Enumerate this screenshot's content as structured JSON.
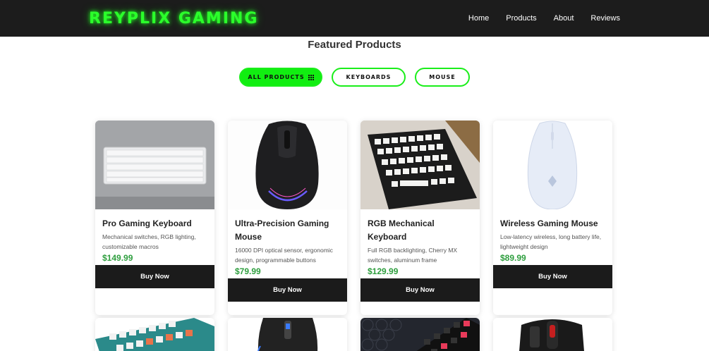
{
  "brand": {
    "logo_text": "REYPLIX GAMING",
    "accent": "#22ff22"
  },
  "nav": {
    "links": [
      "Home",
      "Products",
      "About",
      "Reviews"
    ]
  },
  "section": {
    "title": "Featured Products"
  },
  "filters": [
    {
      "label": "ALL PRODUCTS",
      "active": true,
      "icon": "grid-icon"
    },
    {
      "label": "KEYBOARDS",
      "active": false
    },
    {
      "label": "MOUSE",
      "active": false
    }
  ],
  "products": [
    {
      "name": "Pro Gaming Keyboard",
      "description": "Mechanical switches, RGB lighting, customizable macros",
      "price": "$149.99",
      "button": "Buy Now"
    },
    {
      "name": "Ultra-Precision Gaming Mouse",
      "description": "16000 DPI optical sensor, ergonomic design, programmable buttons",
      "price": "$79.99",
      "button": "Buy Now"
    },
    {
      "name": "RGB Mechanical Keyboard",
      "description": "Full RGB backlighting, Cherry MX switches, aluminum frame",
      "price": "$129.99",
      "button": "Buy Now"
    },
    {
      "name": "Wireless Gaming Mouse",
      "description": "Low-latency wireless, long battery life, lightweight design",
      "price": "$89.99",
      "button": "Buy Now"
    }
  ]
}
